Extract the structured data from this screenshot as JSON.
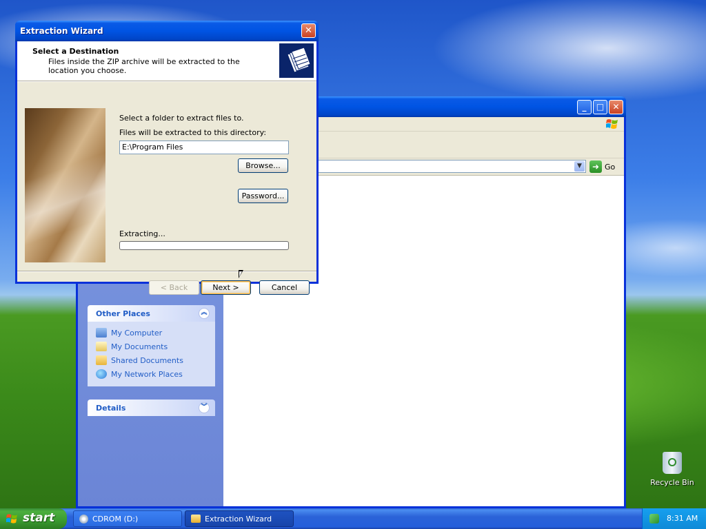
{
  "desktop": {
    "recycle_bin_label": "Recycle Bin"
  },
  "explorer": {
    "address": {
      "go_label": "Go"
    },
    "other_places": {
      "title": "Other Places",
      "items": [
        {
          "label": "My Computer",
          "icon": "my-computer-icon"
        },
        {
          "label": "My Documents",
          "icon": "my-documents-icon"
        },
        {
          "label": "Shared Documents",
          "icon": "shared-documents-icon"
        },
        {
          "label": "My Network Places",
          "icon": "network-places-icon"
        }
      ]
    },
    "details": {
      "title": "Details"
    }
  },
  "wizard": {
    "title": "Extraction Wizard",
    "header_title": "Select a Destination",
    "header_subtitle": "Files inside the ZIP archive will be extracted to the location you choose.",
    "select_folder_text": "Select a folder to extract files to.",
    "directory_label": "Files will be extracted to this directory:",
    "directory_value": "E:\\Program Files",
    "browse_label": "Browse...",
    "password_label": "Password...",
    "extracting_label": "Extracting...",
    "progress": 0,
    "back_label": "< Back",
    "next_label": "Next >",
    "cancel_label": "Cancel"
  },
  "taskbar": {
    "start_label": "start",
    "tasks": [
      {
        "label": "CDROM (D:)",
        "icon": "cdrom-icon"
      },
      {
        "label": "Extraction Wizard",
        "icon": "folder-icon"
      }
    ],
    "clock": "8:31 AM"
  },
  "colors": {
    "title_bar_blue": "#0054e3",
    "taskbar_blue": "#245edb",
    "start_green": "#3a9a30",
    "link_blue": "#215dc6"
  }
}
